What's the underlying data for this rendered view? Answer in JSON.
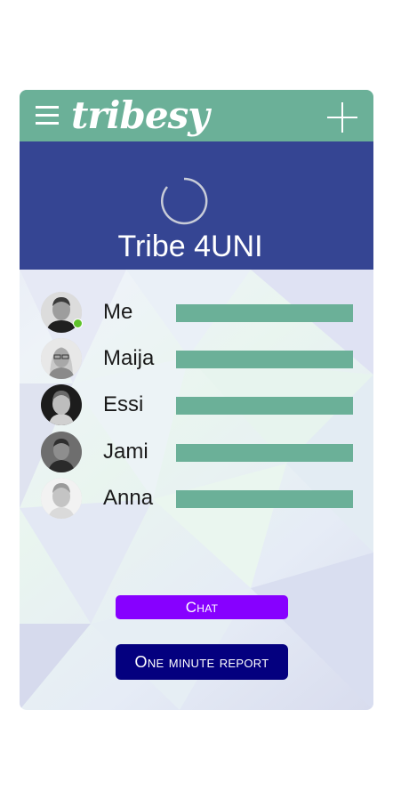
{
  "app": {
    "logo_text": "tribesy",
    "menu_icon": "hamburger-menu-icon",
    "add_icon": "plus-icon"
  },
  "tribe": {
    "title": "Tribe 4UNI",
    "loading_icon": "loading-spinner-icon"
  },
  "members": [
    {
      "name": "Me",
      "online": true,
      "avatar": "male-avatar"
    },
    {
      "name": "Maija",
      "online": false,
      "avatar": "female-avatar-glasses"
    },
    {
      "name": "Essi",
      "online": false,
      "avatar": "female-avatar"
    },
    {
      "name": "Jami",
      "online": false,
      "avatar": "male-avatar-dark"
    },
    {
      "name": "Anna",
      "online": false,
      "avatar": "female-avatar-light"
    }
  ],
  "actions": {
    "chat_label": "Chat",
    "report_label": "One minute report"
  },
  "colors": {
    "topbar": "#6bb098",
    "hero": "#354593",
    "member_bar": "#6bb098",
    "chat_button": "#8700ff",
    "report_button": "#04007f",
    "online": "#5fc32b"
  }
}
